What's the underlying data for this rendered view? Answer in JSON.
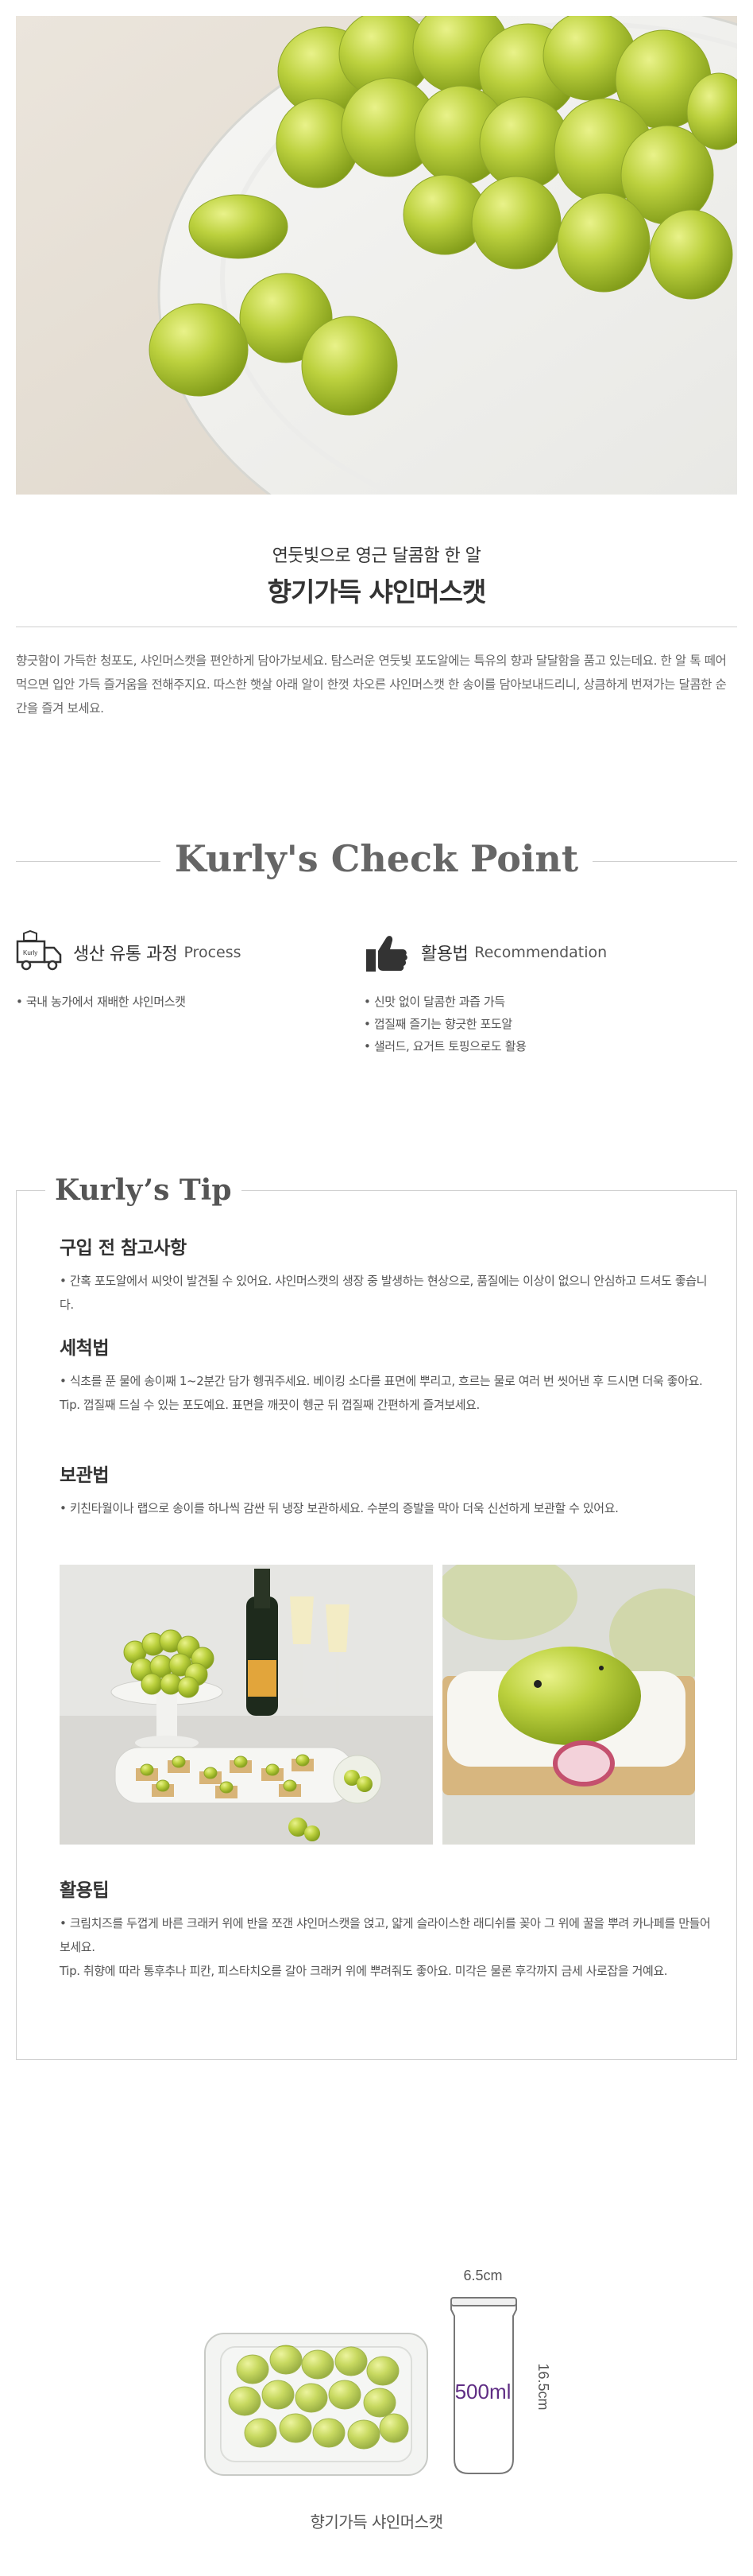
{
  "hero": {
    "alt": "샤인머스캣 포도 사진"
  },
  "intro": {
    "subtitle": "연둣빛으로 영근 달콤함 한 알",
    "title": "향기가득 샤인머스캣",
    "description": "향긋함이 가득한 청포도, 샤인머스캣을 편안하게 담아가보세요. 탐스러운 연둣빛 포도알에는 특유의 향과 달달함을 품고 있는데요. 한 알 톡 떼어 먹으면 입안 가득 즐거움을 전해주지요. 따스한 햇살 아래 알이 한껏 차오른 샤인머스캣 한 송이를 담아보내드리니, 상큼하게 번져가는 달콤한 순간을 즐겨 보세요."
  },
  "checkpoint": {
    "title": "Kurly's Check Point",
    "process": {
      "icon": "delivery-truck-icon",
      "title_ko": "생산 유통 과정",
      "title_en": "Process",
      "items": [
        "• 국내 농가에서 재배한 샤인머스캣"
      ]
    },
    "recommendation": {
      "icon": "thumbs-up-icon",
      "title_ko": "활용법",
      "title_en": "Recommendation",
      "items": [
        "• 신맛 없이 달콤한 과즙 가득",
        "• 껍질째 즐기는 향긋한 포도알",
        "• 샐러드, 요거트 토핑으로도 활용"
      ]
    }
  },
  "tip": {
    "title": "Kurly’s Tip",
    "before_buy": {
      "heading": "구입 전 참고사항",
      "text": "• 간혹 포도알에서 씨앗이 발견될 수 있어요. 샤인머스캣의 생장 중 발생하는 현상으로, 품질에는 이상이 없으니 안심하고 드셔도 좋습니다."
    },
    "washing": {
      "heading": "세척법",
      "text": "• 식초를 푼 물에 송이째 1~2분간 담가 헹궈주세요. 베이킹 소다를 표면에 뿌리고, 흐르는 물로 여러 번 씻어낸 후 드시면 더욱 좋아요.",
      "tip": "Tip. 껍질째 드실 수 있는 포도예요. 표면을 깨끗이 헹군 뒤 껍질째 간편하게 즐겨보세요."
    },
    "storage": {
      "heading": "보관법",
      "text": "• 키친타월이나 랩으로 송이를 하나씩 감싼 뒤 냉장 보관하세요. 수분의 증발을 막아 더욱 신선하게 보관할 수 있어요."
    },
    "usage": {
      "heading": "활용팁",
      "text": "• 크림치즈를 두껍게 바른 크래커 위에 반을 쪼갠 샤인머스캣을 얹고, 얇게 슬라이스한 래디쉬를 꽂아 그 위에 꿀을 뿌려 카나페를 만들어 보세요.",
      "tip": "Tip. 취향에 따라 통후추나 피칸, 피스타치오를 갈아 크래커 위에 뿌려줘도 좋아요. 미각은 물론 후각까지 금세 사로잡을 거예요."
    }
  },
  "package": {
    "width_label": "6.5cm",
    "height_label": "16.5cm",
    "can_label": "500ml",
    "caption": "향기가득 샤인머스캣"
  },
  "colors": {
    "grape": "#b5cc3a",
    "purple": "#5f2d84",
    "line": "#cfcfcf"
  }
}
